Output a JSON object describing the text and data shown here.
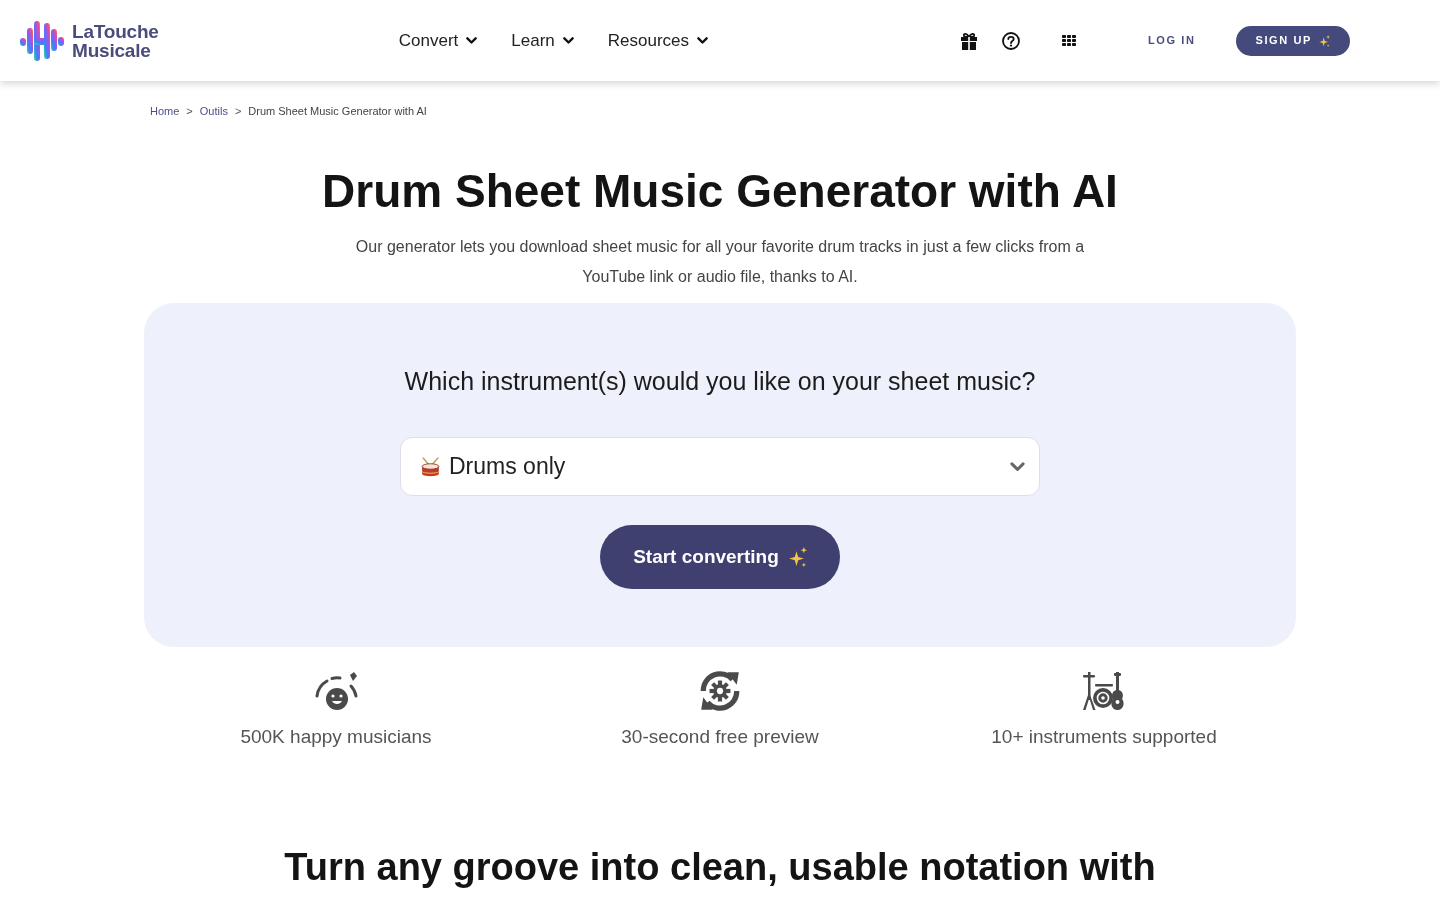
{
  "header": {
    "brand": {
      "line_1": "LaTouche",
      "line_2": "Musicale"
    },
    "nav": [
      {
        "label": "Convert"
      },
      {
        "label": "Learn"
      },
      {
        "label": "Resources"
      }
    ],
    "login": "LOG IN",
    "signup": "SIGN UP"
  },
  "breadcrumb": [
    {
      "label": "Home",
      "kind": "link"
    },
    {
      "separator": ">",
      "label": "Outils",
      "kind": "link"
    },
    {
      "separator": ">",
      "label": "Drum Sheet Music Generator with AI",
      "kind": "current"
    }
  ],
  "hero": {
    "title": "Drum Sheet Music Generator with AI",
    "subtitle": "Our generator lets you download sheet music for all your favorite drum tracks in just a few clicks from a YouTube link or audio file, thanks to AI."
  },
  "converter": {
    "question": "Which instrument(s) would you like on your sheet music?",
    "instrument_select": {
      "value": "Drums only"
    },
    "button": "Start converting"
  },
  "features": [
    {
      "kind": "musicians",
      "text": "500K happy musicians"
    },
    {
      "kind": "preview",
      "text": "30-second free preview"
    },
    {
      "kind": "instruments",
      "text": "10+ instruments supported"
    }
  ],
  "next_section": {
    "heading": "Turn any groove into clean, usable notation with"
  }
}
